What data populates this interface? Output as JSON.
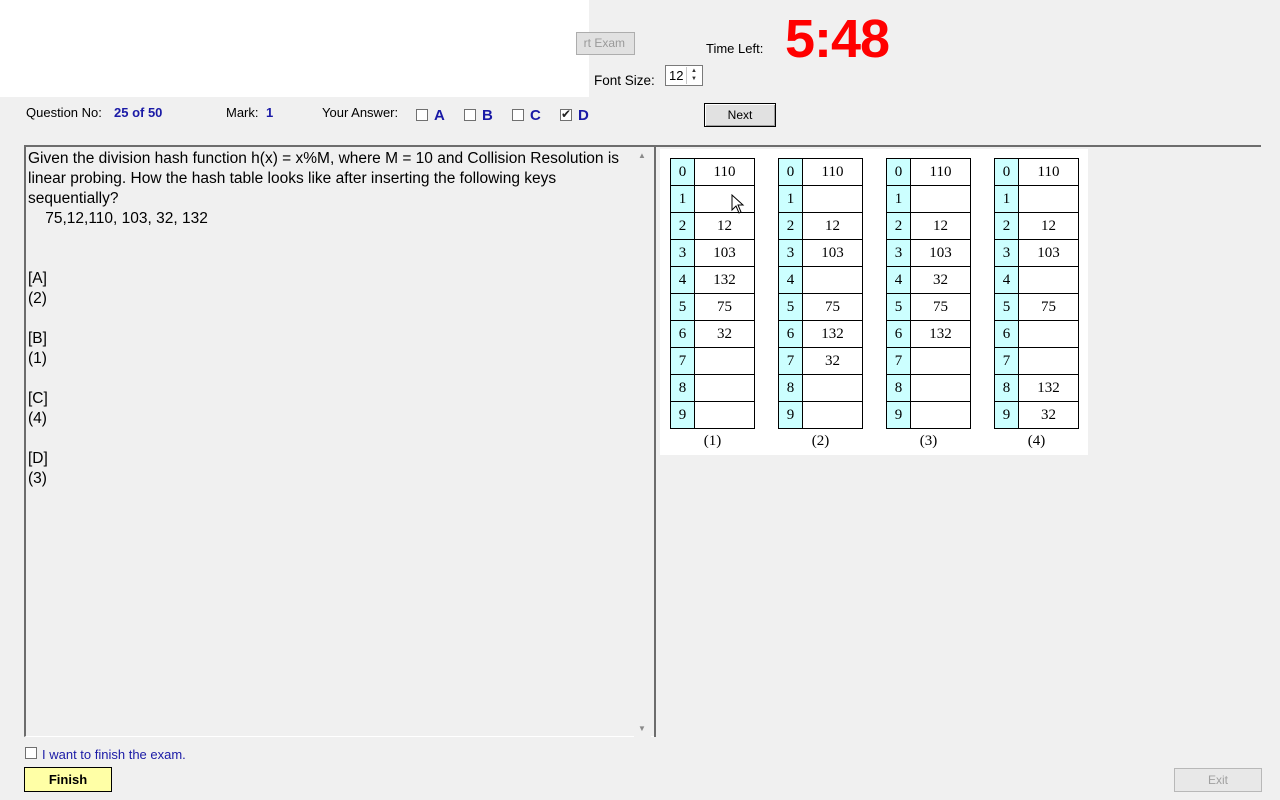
{
  "toolbar": {
    "start_exam_label": "rt Exam",
    "time_left_label": "Time Left:",
    "timer": "5:48",
    "font_size_label": "Font Size:",
    "font_size_value": "12"
  },
  "question_info": {
    "question_no_label": "Question No:",
    "question_no_value": "25 of 50",
    "mark_label": "Mark:",
    "mark_value": "1",
    "your_answer_label": "Your Answer:",
    "options": [
      {
        "letter": "A",
        "checked": false
      },
      {
        "letter": "B",
        "checked": false
      },
      {
        "letter": "C",
        "checked": false
      },
      {
        "letter": "D",
        "checked": true
      }
    ],
    "next_label": "Next"
  },
  "question": {
    "text": "Given the division hash function h(x) = x%M, where M = 10 and Collision Resolution is linear probing. How the hash table looks like after inserting the following keys sequentially?\n    75,12,110, 103, 32, 132\n\n\n[A]\n(2)\n\n[B]\n(1)\n\n[C]\n(4)\n\n[D]\n(3)"
  },
  "hash_tables": [
    {
      "caption": "(1)",
      "indices": [
        "0",
        "1",
        "2",
        "3",
        "4",
        "5",
        "6",
        "7",
        "8",
        "9"
      ],
      "values": [
        "110",
        "",
        "12",
        "103",
        "132",
        "75",
        "32",
        "",
        "",
        ""
      ]
    },
    {
      "caption": "(2)",
      "indices": [
        "0",
        "1",
        "2",
        "3",
        "4",
        "5",
        "6",
        "7",
        "8",
        "9"
      ],
      "values": [
        "110",
        "",
        "12",
        "103",
        "",
        "75",
        "132",
        "32",
        "",
        ""
      ]
    },
    {
      "caption": "(3)",
      "indices": [
        "0",
        "1",
        "2",
        "3",
        "4",
        "5",
        "6",
        "7",
        "8",
        "9"
      ],
      "values": [
        "110",
        "",
        "12",
        "103",
        "32",
        "75",
        "132",
        "",
        "",
        ""
      ]
    },
    {
      "caption": "(4)",
      "indices": [
        "0",
        "1",
        "2",
        "3",
        "4",
        "5",
        "6",
        "7",
        "8",
        "9"
      ],
      "values": [
        "110",
        "",
        "12",
        "103",
        "",
        "75",
        "",
        "",
        "132",
        "32"
      ]
    }
  ],
  "footer": {
    "finish_checkbox_label": "I want to finish the exam.",
    "finish_label": "Finish",
    "exit_label": "Exit"
  }
}
